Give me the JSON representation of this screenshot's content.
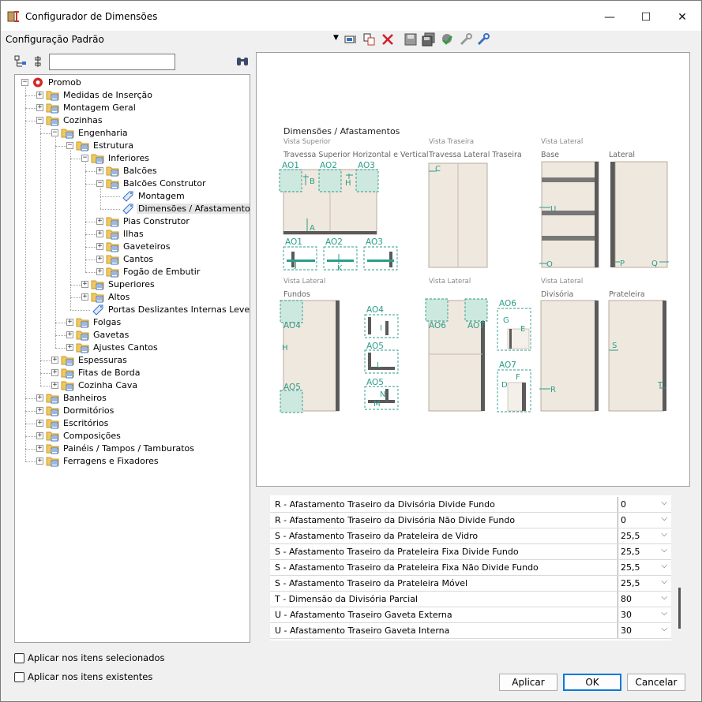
{
  "window": {
    "title": "Configurador de Dimensões",
    "minimize": "—",
    "maximize": "☐",
    "close": "✕"
  },
  "toolbar": {
    "config_name": "Configuração Padrão",
    "dropdown_arrow": "▼"
  },
  "tree": {
    "items": [
      {
        "label": "Promob",
        "level": 0,
        "expander": "−",
        "icon": "promob-icon"
      },
      {
        "label": "Medidas de Inserção",
        "level": 1,
        "expander": "+",
        "icon": "folder-icon"
      },
      {
        "label": "Montagem Geral",
        "level": 1,
        "expander": "+",
        "icon": "folder-icon"
      },
      {
        "label": "Cozinhas",
        "level": 1,
        "expander": "−",
        "icon": "folder-icon"
      },
      {
        "label": "Engenharia",
        "level": 2,
        "expander": "−",
        "icon": "folder-icon"
      },
      {
        "label": "Estrutura",
        "level": 3,
        "expander": "−",
        "icon": "folder-icon"
      },
      {
        "label": "Inferiores",
        "level": 4,
        "expander": "−",
        "icon": "folder-icon"
      },
      {
        "label": "Balcões",
        "level": 5,
        "expander": "+",
        "icon": "folder-icon"
      },
      {
        "label": "Balcões Construtor",
        "level": 5,
        "expander": "−",
        "icon": "folder-icon"
      },
      {
        "label": "Montagem",
        "level": 6,
        "expander": "",
        "icon": "tag-icon"
      },
      {
        "label": "Dimensões / Afastamentos",
        "level": 6,
        "expander": "",
        "icon": "tag-icon",
        "selected": true
      },
      {
        "label": "Pias Construtor",
        "level": 5,
        "expander": "+",
        "icon": "folder-icon"
      },
      {
        "label": "Ilhas",
        "level": 5,
        "expander": "+",
        "icon": "folder-icon"
      },
      {
        "label": "Gaveteiros",
        "level": 5,
        "expander": "+",
        "icon": "folder-icon"
      },
      {
        "label": "Cantos",
        "level": 5,
        "expander": "+",
        "icon": "folder-icon"
      },
      {
        "label": "Fogão de Embutir",
        "level": 5,
        "expander": "+",
        "icon": "folder-icon"
      },
      {
        "label": "Superiores",
        "level": 4,
        "expander": "+",
        "icon": "folder-icon"
      },
      {
        "label": "Altos",
        "level": 4,
        "expander": "+",
        "icon": "folder-icon"
      },
      {
        "label": "Portas Deslizantes Internas Leves",
        "level": 4,
        "expander": "",
        "icon": "tag-icon"
      },
      {
        "label": "Folgas",
        "level": 3,
        "expander": "+",
        "icon": "folder-icon"
      },
      {
        "label": "Gavetas",
        "level": 3,
        "expander": "+",
        "icon": "folder-icon"
      },
      {
        "label": "Ajustes Cantos",
        "level": 3,
        "expander": "+",
        "icon": "folder-icon"
      },
      {
        "label": "Espessuras",
        "level": 2,
        "expander": "+",
        "icon": "folder-icon"
      },
      {
        "label": "Fitas de Borda",
        "level": 2,
        "expander": "+",
        "icon": "folder-icon"
      },
      {
        "label": "Cozinha Cava",
        "level": 2,
        "expander": "+",
        "icon": "folder-icon"
      },
      {
        "label": "Banheiros",
        "level": 1,
        "expander": "+",
        "icon": "folder-icon"
      },
      {
        "label": "Dormitórios",
        "level": 1,
        "expander": "+",
        "icon": "folder-icon"
      },
      {
        "label": "Escritórios",
        "level": 1,
        "expander": "+",
        "icon": "folder-icon"
      },
      {
        "label": "Composições",
        "level": 1,
        "expander": "+",
        "icon": "folder-icon"
      },
      {
        "label": "Painéis / Tampos / Tamburatos",
        "level": 1,
        "expander": "+",
        "icon": "folder-icon"
      },
      {
        "label": "Ferragens e Fixadores",
        "level": 1,
        "expander": "+",
        "icon": "folder-icon"
      }
    ]
  },
  "preview": {
    "title": "Dimensões / Afastamentos",
    "views": {
      "superior": "Vista Superior",
      "traseira": "Vista Traseira",
      "lateral1": "Vista Lateral",
      "lateral2": "Vista Lateral",
      "lateral3": "Vista Lateral",
      "lateral4": "Vista Lateral"
    },
    "subtitles": {
      "travessa_sup": "Travessa Superior Horizontal e Vertical",
      "travessa_tras": "Travessa Lateral Traseira",
      "base": "Base",
      "lateral": "Lateral",
      "fundos": "Fundos",
      "divisoria": "Divisória",
      "prateleira": "Prateleira"
    },
    "tags": {
      "ao1": "AO1",
      "ao2": "AO2",
      "ao3": "AO3",
      "ao4": "AO4",
      "ao5": "AO5",
      "ao6": "AO6",
      "ao7": "AO7"
    },
    "letters": {
      "a": "A",
      "b": "B",
      "c": "C",
      "d": "D",
      "e": "E",
      "f": "F",
      "g": "G",
      "h": "H",
      "i": "I",
      "j": "J",
      "k": "K",
      "l": "L",
      "m": "M",
      "n": "N",
      "o": "O",
      "p": "P",
      "q": "Q",
      "r": "R",
      "s": "S",
      "t": "T",
      "u": "U"
    },
    "colors": {
      "accent": "#2a9d8a",
      "panel": "#efe8df",
      "edge": "#7a6a5a",
      "dark": "#555555"
    }
  },
  "properties": [
    {
      "name": "R - Afastamento Traseiro da Divisória Divide Fundo",
      "value": "0"
    },
    {
      "name": "R - Afastamento Traseiro da Divisória Não Divide Fundo",
      "value": "0"
    },
    {
      "name": "S - Afastamento Traseiro da Prateleira de Vidro",
      "value": "25,5"
    },
    {
      "name": "S - Afastamento Traseiro da Prateleira Fixa Divide Fundo",
      "value": "25,5"
    },
    {
      "name": "S - Afastamento Traseiro da Prateleira Fixa Não Divide Fundo",
      "value": "25,5"
    },
    {
      "name": "S - Afastamento Traseiro da Prateleira Móvel",
      "value": "25,5"
    },
    {
      "name": "T - Dimensão da Divisória Parcial",
      "value": "80"
    },
    {
      "name": "U - Afastamento Traseiro Gaveta Externa",
      "value": "30"
    },
    {
      "name": "U - Afastamento Traseiro Gaveta Interna",
      "value": "30"
    }
  ],
  "dropdown_arrow_small": "⌵",
  "footer": {
    "check_selected": "Aplicar nos itens selecionados",
    "check_existing": "Aplicar nos itens existentes",
    "apply": "Aplicar",
    "ok": "OK",
    "cancel": "Cancelar"
  }
}
